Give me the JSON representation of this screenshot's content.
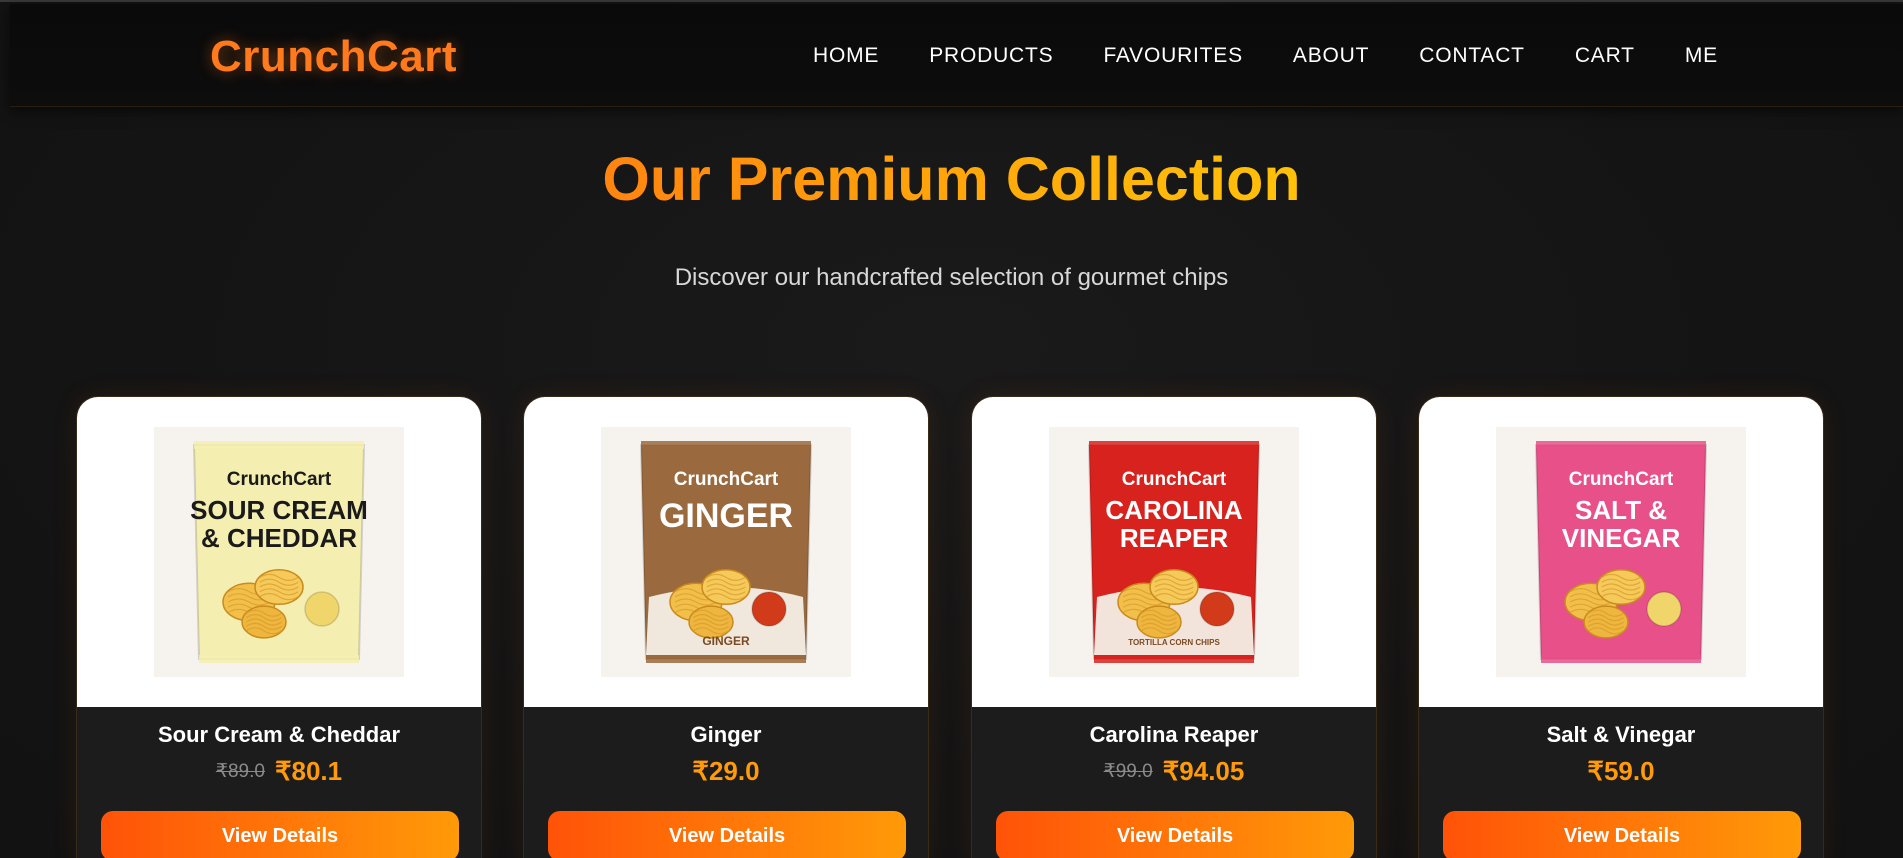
{
  "navbar": {
    "brand": "CrunchCart",
    "links": [
      "HOME",
      "PRODUCTS",
      "FAVOURITES",
      "ABOUT",
      "CONTACT",
      "CART",
      "ME"
    ]
  },
  "hero": {
    "title": "Our Premium Collection",
    "subtitle": "Discover our handcrafted selection of gourmet chips"
  },
  "products": [
    {
      "name": "Sour Cream & Cheddar",
      "old_price": "₹89.0",
      "price": "₹80.1",
      "button": "View Details",
      "pack_brand": "CrunchCart",
      "pack_line1": "SOUR CREAM",
      "pack_line2": "& CHEDDAR",
      "pack_footer": "",
      "pack_color": "#f4efb0",
      "pack_text_color": "#1a1a1a",
      "image_icon": "chip-bag-image"
    },
    {
      "name": "Ginger",
      "old_price": "",
      "price": "₹29.0",
      "button": "View Details",
      "pack_brand": "CrunchCart",
      "pack_line1": "GINGER",
      "pack_line2": "",
      "pack_footer": "GINGER",
      "pack_color": "#9a6a3e",
      "pack_text_color": "#ffffff",
      "image_icon": "chip-bag-image"
    },
    {
      "name": "Carolina Reaper",
      "old_price": "₹99.0",
      "price": "₹94.05",
      "button": "View Details",
      "pack_brand": "CrunchCart",
      "pack_line1": "CAROLINA",
      "pack_line2": "REAPER",
      "pack_footer": "TORTILLA CORN CHIPS",
      "pack_color": "#d8221e",
      "pack_text_color": "#ffffff",
      "image_icon": "chip-bag-image"
    },
    {
      "name": "Salt & Vinegar",
      "old_price": "",
      "price": "₹59.0",
      "button": "View Details",
      "pack_brand": "CrunchCart",
      "pack_line1": "SALT &",
      "pack_line2": "VINEGAR",
      "pack_footer": "",
      "pack_color": "#e8508a",
      "pack_text_color": "#ffffff",
      "image_icon": "chip-bag-image"
    }
  ],
  "colors": {
    "accent": "#ff7a1c",
    "price": "#ff9a0a",
    "button_start": "#ff5308",
    "button_end": "#ff9a08",
    "background": "#151515"
  }
}
